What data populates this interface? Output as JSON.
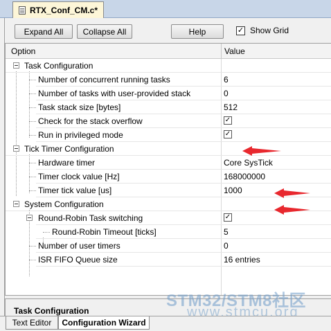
{
  "file_tab": {
    "title": "RTX_Conf_CM.c*"
  },
  "toolbar": {
    "expand_all": "Expand All",
    "collapse_all": "Collapse All",
    "help": "Help",
    "show_grid_label": "Show Grid",
    "show_grid_checked": true
  },
  "grid": {
    "columns": {
      "option": "Option",
      "value": "Value"
    },
    "rows": [
      {
        "label": "Task Configuration",
        "value": ""
      },
      {
        "label": "Number of concurrent running tasks",
        "value": "6"
      },
      {
        "label": "Number of tasks with user-provided stack",
        "value": "0"
      },
      {
        "label": "Task stack size [bytes]",
        "value": "512"
      },
      {
        "label": "Check for the stack overflow",
        "value": "✓"
      },
      {
        "label": "Run in privileged mode",
        "value": "✓"
      },
      {
        "label": "Tick Timer Configuration",
        "value": ""
      },
      {
        "label": "Hardware timer",
        "value": "Core SysTick"
      },
      {
        "label": "Timer clock value [Hz]",
        "value": "168000000"
      },
      {
        "label": "Timer tick value [us]",
        "value": "1000"
      },
      {
        "label": "System Configuration",
        "value": ""
      },
      {
        "label": "Round-Robin Task switching",
        "value": "✓"
      },
      {
        "label": "Round-Robin Timeout [ticks]",
        "value": "5"
      },
      {
        "label": "Number of user timers",
        "value": "0"
      },
      {
        "label": "ISR FIFO Queue size",
        "value": "16 entries"
      }
    ]
  },
  "description": {
    "title": "Task Configuration"
  },
  "watermark": {
    "line1": "STM32/STM8社区",
    "line2": "www.stmcu.org"
  },
  "bottom_tabs": {
    "text_editor": "Text Editor",
    "configuration_wizard": "Configuration Wizard"
  },
  "colors": {
    "annotation_arrow": "#e8282e",
    "file_tab_bg": "#fdf6d8",
    "tab_strip_bg": "#c8d6e8"
  }
}
